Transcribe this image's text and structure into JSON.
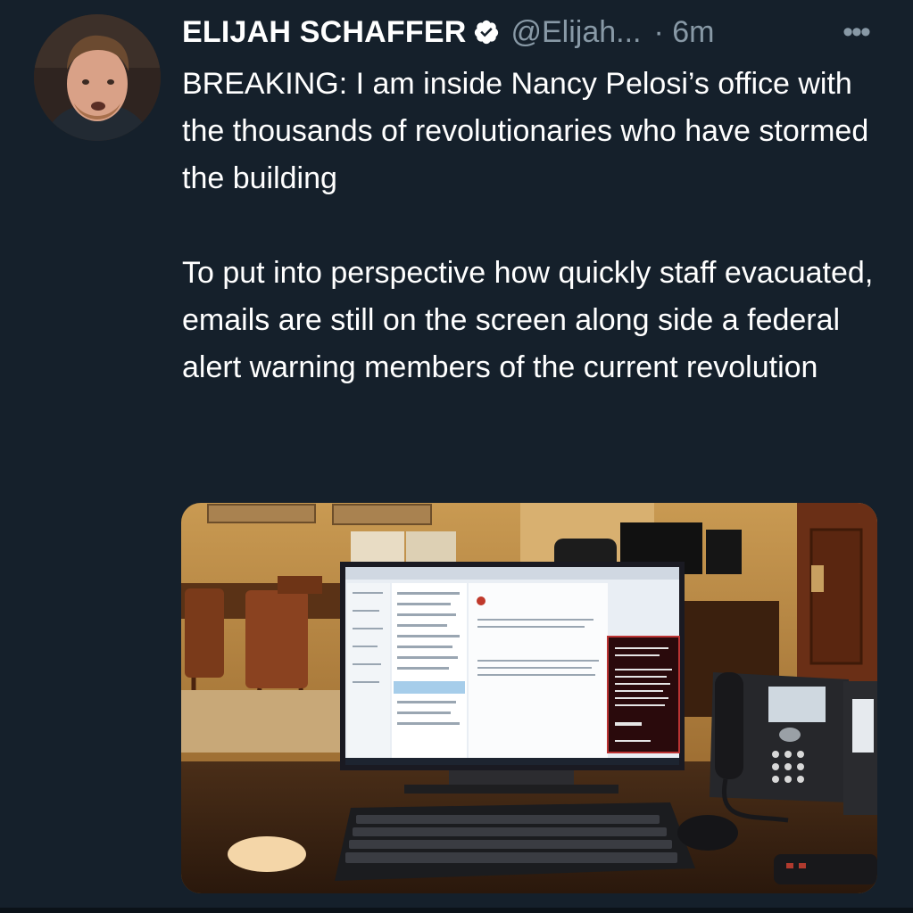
{
  "tweet": {
    "author_name": "ELIJAH SCHAFFER",
    "handle": "@Elijah...",
    "timestamp": "· 6m",
    "more_label": "•••",
    "paragraphs": [
      "BREAKING: I am inside Nancy Pelosi’s office with the thousands of revolutionaries who have stormed the building",
      "To put into perspective how quickly staff evacuated, emails are still on the screen along side a federal alert warning members of the current revolution"
    ],
    "icons": {
      "verified": "verified-badge-icon",
      "more": "more-options-icon"
    }
  },
  "media": {
    "type": "photo",
    "alert_heading": "Capitol Internal Security Threat Police Activity"
  },
  "colors": {
    "background": "#15202b",
    "text": "#ffffff",
    "muted": "#8899a6"
  }
}
